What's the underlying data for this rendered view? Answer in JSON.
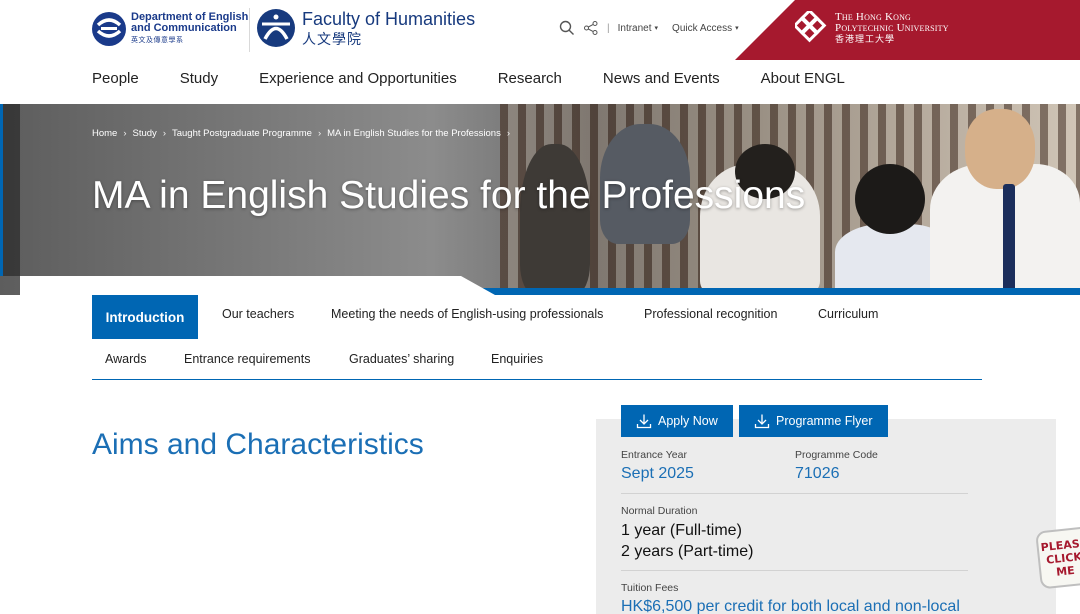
{
  "header": {
    "dept": {
      "line1": "Department of English",
      "line2": "and Communication",
      "zh": "英文及傳意學系"
    },
    "faculty": {
      "en": "Faculty of Humanities",
      "zh": "人文學院"
    },
    "utility": {
      "intranet": "Intranet",
      "quick_access": "Quick Access"
    },
    "university": {
      "line1": "The Hong Kong",
      "line2": "Polytechnic University",
      "zh": "香港理工大學"
    },
    "colors": {
      "brand_red": "#a6192e",
      "brand_blue": "#0066b3",
      "navy": "#173a7e"
    }
  },
  "nav": {
    "items": [
      "People",
      "Study",
      "Experience and Opportunities",
      "Research",
      "News and Events",
      "About ENGL"
    ]
  },
  "hero": {
    "breadcrumb": [
      "Home",
      "Study",
      "Taught Postgraduate Programme",
      "MA in English Studies for the Professions"
    ],
    "title": "MA in English Studies for the Professions"
  },
  "tabs": {
    "row1": [
      "Introduction",
      "Our teachers",
      "Meeting the needs of English-using professionals",
      "Professional recognition",
      "Curriculum"
    ],
    "row2": [
      "Awards",
      "Entrance requirements",
      "Graduates’ sharing",
      "Enquiries"
    ],
    "active": "Introduction"
  },
  "content": {
    "section_title": "Aims and Characteristics"
  },
  "infobox": {
    "apply_label": "Apply Now",
    "flyer_label": "Programme Flyer",
    "entrance_year_label": "Entrance Year",
    "entrance_year": "Sept 2025",
    "programme_code_label": "Programme Code",
    "programme_code": "71026",
    "duration_label": "Normal Duration",
    "duration_ft": "1 year (Full-time)",
    "duration_pt": "2 years (Part-time)",
    "tuition_label": "Tuition Fees",
    "tuition": "HK$6,500 per credit for both local and non-local"
  },
  "badge": {
    "text": "PLEASE CLICK ME"
  }
}
